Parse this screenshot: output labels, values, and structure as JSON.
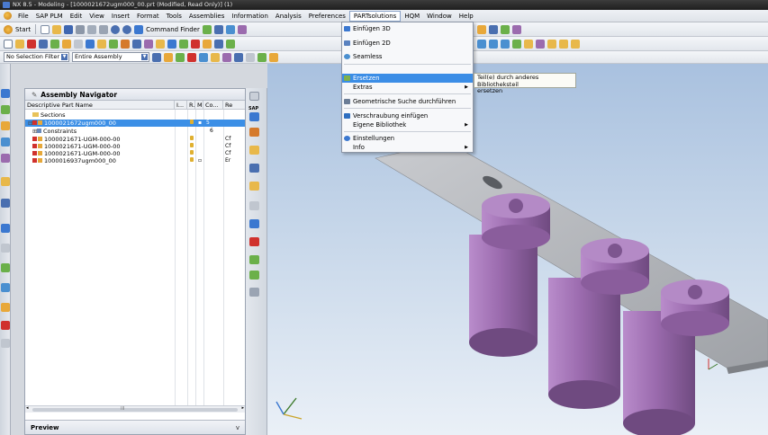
{
  "window": {
    "title": "NX 8.5 - Modeling - [1000021672ugm000_00.prt (Modified, Read Only)]  (1)"
  },
  "menubar": {
    "items": [
      "File",
      "SAP PLM",
      "Edit",
      "View",
      "Insert",
      "Format",
      "Tools",
      "Assemblies",
      "Information",
      "Analysis",
      "Preferences",
      "PARTsolutions",
      "HQM",
      "Window",
      "Help"
    ],
    "active_index": 11
  },
  "toolbar": {
    "start_label": "Start",
    "command_finder_label": "Command Finder"
  },
  "selection_bar": {
    "filter_value": "No Selection Filter",
    "scope_value": "Entire Assembly"
  },
  "navigator": {
    "title": "Assembly Navigator",
    "columns": [
      "Descriptive Part Name",
      "I...",
      "R.",
      "M",
      "Co...",
      "Re"
    ],
    "rows": [
      {
        "name": "Sections",
        "co": ""
      },
      {
        "name": "1000021672ugm000_00",
        "co": "5"
      },
      {
        "name": "Constraints",
        "co": "6"
      },
      {
        "name": "1000021671-UGM-000-00",
        "re": "Cf"
      },
      {
        "name": "1000021671-UGM-000-00",
        "re": "Cf"
      },
      {
        "name": "1000021671-UGM-000-00",
        "re": "Cf"
      },
      {
        "name": "1000016937ugm000_00",
        "re": "Er"
      }
    ],
    "scroll_marker": "III",
    "preview_label": "Preview",
    "preview_chevron": "v"
  },
  "side_toolbar": {
    "sap_label": "SAP"
  },
  "partsolutions_menu": {
    "items": [
      {
        "label": "Einfügen 3D",
        "icon": "insert-3d-icon",
        "submenu": false
      },
      {
        "label": "Einfügen 2D",
        "icon": "insert-2d-icon",
        "submenu": false
      },
      {
        "label": "Seamless",
        "icon": "seamless-icon",
        "submenu": false
      },
      {
        "label": "Ersetzen",
        "icon": "replace-icon",
        "submenu": false,
        "highlighted": true
      },
      {
        "label": "Extras",
        "icon": "",
        "submenu": true
      },
      {
        "label": "Geometrische Suche durchführen",
        "icon": "geometric-search-icon",
        "submenu": false
      },
      {
        "label": "Verschraubung einfügen",
        "icon": "insert-screw-icon",
        "submenu": false
      },
      {
        "label": "Eigene Bibliothek",
        "icon": "",
        "submenu": true
      },
      {
        "label": "Einstellungen",
        "icon": "settings-icon",
        "submenu": false
      },
      {
        "label": "Info",
        "icon": "",
        "submenu": true
      }
    ]
  },
  "tooltip": {
    "line1": "Teil(e) durch anderes Bibliotheksteil",
    "line2": "ersetzen"
  },
  "colors": {
    "selection": "#3b8de6",
    "part_purple": "#9b6bae",
    "plate_gray": "#b4b6ba"
  }
}
